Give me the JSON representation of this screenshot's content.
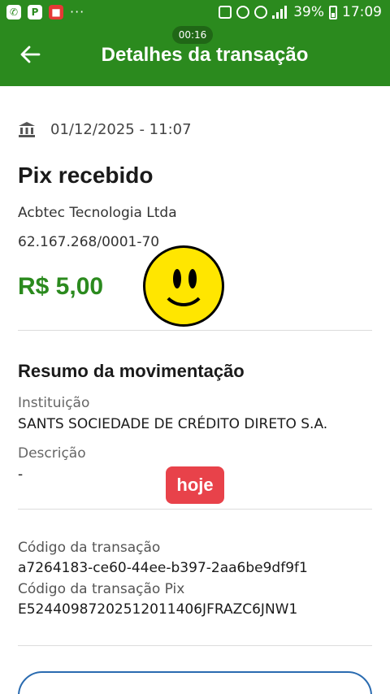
{
  "status_bar": {
    "timer": "00:16",
    "battery": "39%",
    "time": "17:09",
    "left_icons": [
      "whatsapp-icon",
      "parking-icon",
      "app-icon",
      "more-icon"
    ],
    "accent": "#2b8a1e"
  },
  "header": {
    "title": "Detalhes da transação"
  },
  "transaction": {
    "datetime": "01/12/2025 - 11:07",
    "type": "Pix recebido",
    "payer": "Acbtec Tecnologia Ltda",
    "cnpj": "62.167.268/0001-70",
    "amount": "R$ 5,00",
    "amount_color": "#2b8a1e"
  },
  "summary": {
    "title": "Resumo da movimentação",
    "institution_label": "Instituição",
    "institution_value": "SANTS SOCIEDADE DE CRÉDITO DIRETO S.A.",
    "description_label": "Descrição",
    "description_value": "-",
    "badge": "hoje"
  },
  "codes": {
    "tx_code_label": "Código da transação",
    "tx_code_value": "a7264183-ce60-44ee-b397-2aa6be9df9f1",
    "pix_code_label": "Código da transação Pix",
    "pix_code_value": "E52440987202512011406JFRAZC6JNW1"
  }
}
